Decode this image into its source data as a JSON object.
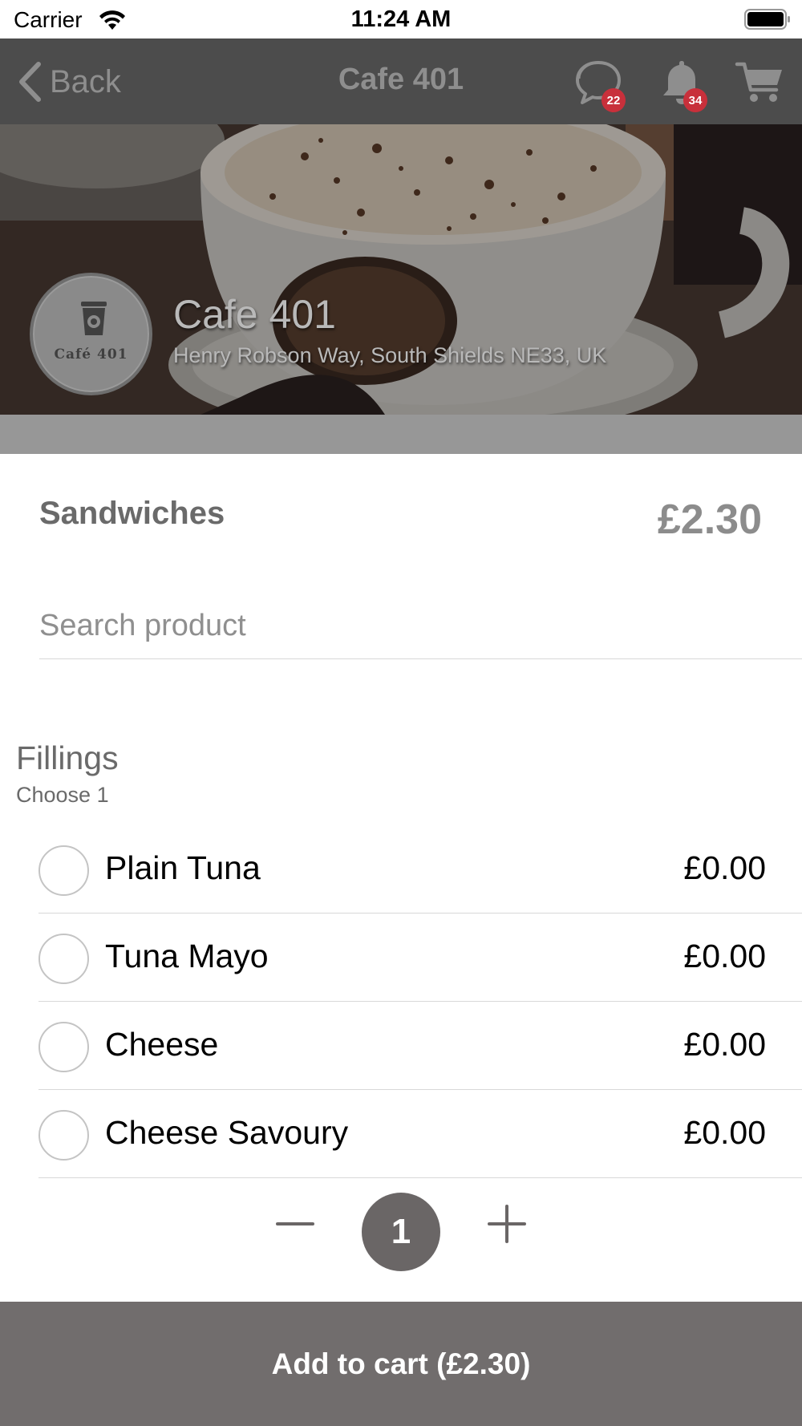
{
  "status_bar": {
    "carrier": "Carrier",
    "time": "11:24 AM",
    "wifi_icon": "wifi-icon",
    "battery_icon": "battery-icon"
  },
  "navbar": {
    "back_label": "Back",
    "title": "Cafe 401",
    "chat_badge": "22",
    "notification_badge": "34",
    "icons": [
      "chevron-left-icon",
      "chat-icon",
      "bell-icon",
      "cart-icon"
    ]
  },
  "shop": {
    "name": "Cafe 401",
    "address": "Henry Robson Way, South Shields NE33, UK",
    "logo_text": "Café 401"
  },
  "product": {
    "name": "Sandwiches",
    "price": "£2.30"
  },
  "search": {
    "placeholder": "Search product",
    "value": ""
  },
  "option_group": {
    "title": "Fillings",
    "subtitle": "Choose 1",
    "options": [
      {
        "label": "Plain Tuna",
        "price": "£0.00",
        "selected": false
      },
      {
        "label": "Tuna Mayo",
        "price": "£0.00",
        "selected": false
      },
      {
        "label": "Cheese",
        "price": "£0.00",
        "selected": false
      },
      {
        "label": "Cheese Savoury",
        "price": "£0.00",
        "selected": false
      }
    ]
  },
  "quantity": {
    "value": "1"
  },
  "cart_button": {
    "label": "Add to cart (£2.30)"
  },
  "colors": {
    "navbar": "#4c4c4c",
    "badge": "#c8303b",
    "quantity_bubble": "#6a6666",
    "cart_button": "#716d6d"
  }
}
